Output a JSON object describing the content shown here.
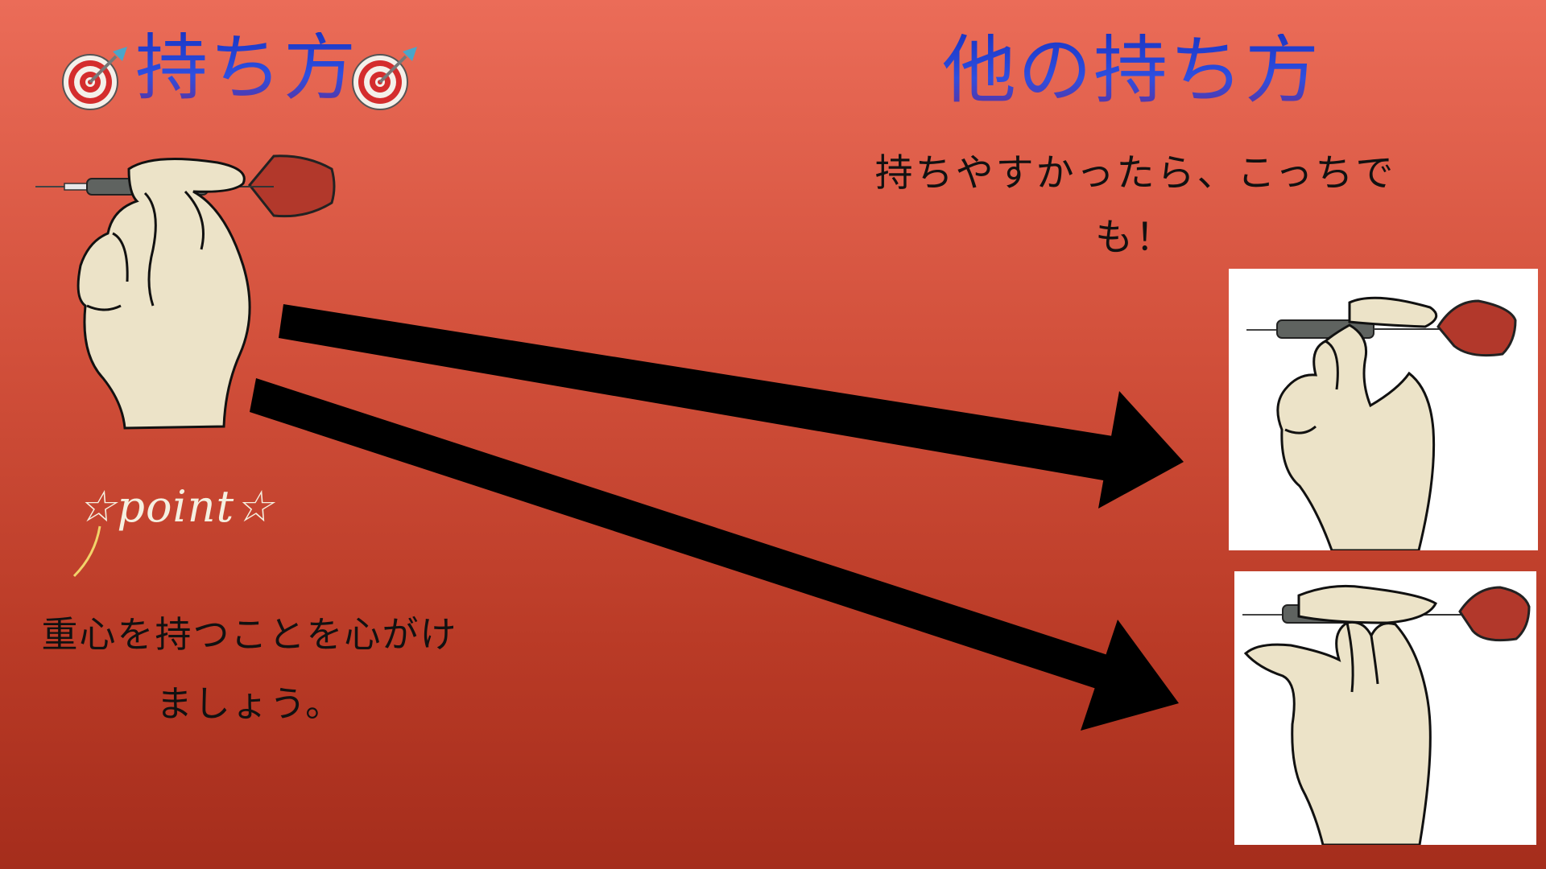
{
  "left": {
    "title": "持ち方",
    "point_label": "☆point☆",
    "note": "重心を持つことを心がけましょう。",
    "icons": [
      "dartboard-icon",
      "dartboard-icon",
      "hand-holding-dart-illustration"
    ]
  },
  "right": {
    "title": "他の持ち方",
    "subtitle": "持ちやすかったら、こっちでも！",
    "photos": [
      "hand-holding-dart-variant-1",
      "hand-holding-dart-variant-2"
    ]
  },
  "colors": {
    "background_top": "#eb6c58",
    "background_bottom": "#a52d1c",
    "title": "#1e3dcc",
    "arrow": "#000000",
    "skin": "#ece3c8",
    "dart_flight": "#b2382b"
  }
}
